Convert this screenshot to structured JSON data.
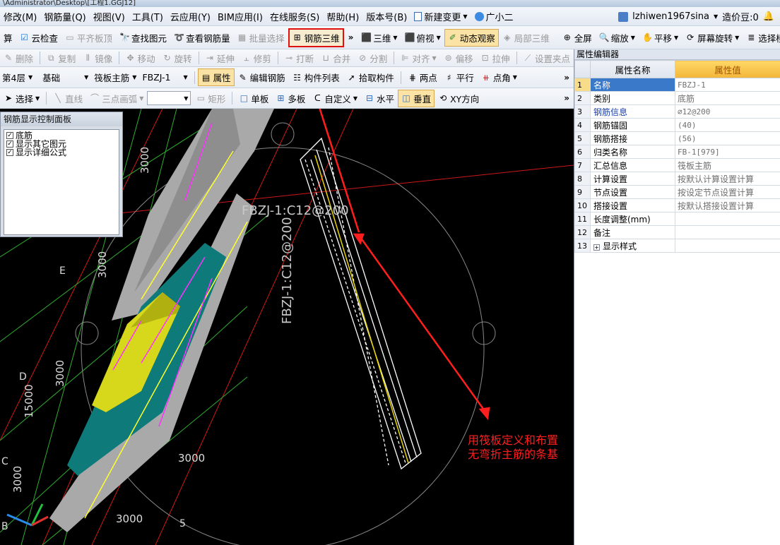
{
  "title": "\\Administrator\\Desktop\\[工程1.GGJ12]",
  "menu": [
    {
      "label": "修改(M)"
    },
    {
      "label": "钢筋量(Q)"
    },
    {
      "label": "视图(V)"
    },
    {
      "label": "工具(T)"
    },
    {
      "label": "云应用(Y)"
    },
    {
      "label": "BIM应用(I)"
    },
    {
      "label": "在线服务(S)"
    },
    {
      "label": "帮助(H)"
    },
    {
      "label": "版本号(B)"
    },
    {
      "label": "新建变更"
    },
    {
      "label": "广小二"
    }
  ],
  "user": {
    "name": "lzhiwen1967sina",
    "beans": "造价豆:0"
  },
  "toolbar1": {
    "calc": "算",
    "cloud_check": "云检查",
    "align_top": "平齐板顶",
    "find_element": "查找图元",
    "view_rebar": "查看钢筋量",
    "batch_select": "批量选择",
    "rebar_3d": "钢筋三维",
    "three_d": "三维",
    "top_view": "俯视",
    "dynamic_view": "动态观察",
    "partial_3d": "局部三维",
    "full_screen": "全屏",
    "zoom": "缩放",
    "pan": "平移",
    "screen_rotate": "屏幕旋转",
    "select_layer": "选择楼"
  },
  "toolbar2": {
    "delete": "删除",
    "copy": "复制",
    "mirror": "镜像",
    "move": "移动",
    "rotate": "旋转",
    "extend": "延伸",
    "trim": "修剪",
    "break": "打断",
    "merge": "合并",
    "split": "分割",
    "align": "对齐",
    "offset": "偏移",
    "stretch": "拉伸",
    "set_grip": "设置夹点"
  },
  "toolbar3": {
    "floor": "第4层",
    "category": "基础",
    "type": "筏板主筋",
    "element": "FBZJ-1",
    "property": "属性",
    "edit_rebar": "编辑钢筋",
    "element_list": "构件列表",
    "pick": "拾取构件",
    "two_points": "两点",
    "parallel": "平行",
    "point_angle": "点角"
  },
  "toolbar4": {
    "select": "选择",
    "line": "直线",
    "arc": "三点画弧",
    "rect": "矩形",
    "single": "单板",
    "multi": "多板",
    "custom": "自定义",
    "horizontal": "水平",
    "vertical": "垂直",
    "xy": "XY方向"
  },
  "control_panel": {
    "title": "钢筋显示控制面板",
    "items": [
      {
        "label": "底筋",
        "checked": true
      },
      {
        "label": "显示其它图元",
        "checked": true
      },
      {
        "label": "显示详细公式",
        "checked": true
      }
    ]
  },
  "viewport": {
    "label_horizontal": "FBZJ-1:C12@200",
    "label_vertical": "FBZJ-1:C12@200",
    "dims": [
      "3000",
      "3000",
      "3000",
      "15000",
      "3000",
      "3000",
      "3000"
    ],
    "axes": [
      "E",
      "D",
      "C",
      "B",
      "5"
    ]
  },
  "annotation": [
    "用筏板定义和布置",
    "无弯折主筋的条基"
  ],
  "property_editor": {
    "title": "属性编辑器",
    "col_name": "属性名称",
    "col_value": "属性值",
    "rows": [
      {
        "n": "1",
        "name": "名称",
        "value": "FBZJ-1"
      },
      {
        "n": "2",
        "name": "类别",
        "value": "底筋"
      },
      {
        "n": "3",
        "name": "钢筋信息",
        "value": "⌀12@200"
      },
      {
        "n": "4",
        "name": "钢筋锚固",
        "value": "(40)"
      },
      {
        "n": "5",
        "name": "钢筋搭接",
        "value": "(56)"
      },
      {
        "n": "6",
        "name": "归类名称",
        "value": "FB-1[979]"
      },
      {
        "n": "7",
        "name": "汇总信息",
        "value": "筏板主筋"
      },
      {
        "n": "8",
        "name": "计算设置",
        "value": "按默认计算设置计算"
      },
      {
        "n": "9",
        "name": "节点设置",
        "value": "按设定节点设置计算"
      },
      {
        "n": "10",
        "name": "搭接设置",
        "value": "按默认搭接设置计算"
      },
      {
        "n": "11",
        "name": "长度调整(mm)",
        "value": ""
      },
      {
        "n": "12",
        "name": "备注",
        "value": ""
      },
      {
        "n": "13",
        "name": "显示样式",
        "value": ""
      }
    ]
  },
  "colors": {
    "accent_red": "#ff1e1e",
    "selection_blue": "#3a78c9",
    "header_orange": "#f2b63a"
  }
}
